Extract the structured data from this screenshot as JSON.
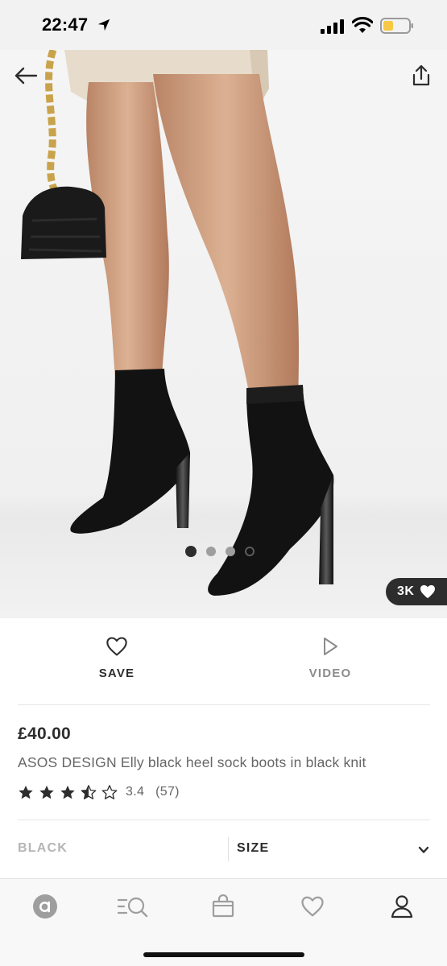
{
  "status_bar": {
    "time": "22:47",
    "icons": [
      "location-arrow-icon",
      "cellular-signal-icon",
      "wifi-icon",
      "battery-icon"
    ]
  },
  "gallery": {
    "image_count": 4,
    "active_index": 0,
    "like_count": "3K",
    "icons": {
      "back": "back-arrow-icon",
      "share": "share-icon",
      "like": "heart-icon"
    }
  },
  "actions": {
    "save_label": "SAVE",
    "video_label": "VIDEO",
    "icons": {
      "save": "heart-outline-icon",
      "video": "play-outline-icon"
    }
  },
  "product": {
    "price": "£40.00",
    "title": "ASOS DESIGN Elly black heel sock boots in black knit",
    "rating_value": "3.4",
    "rating_count": "(57)",
    "stars": 3.5,
    "stars_max": 5
  },
  "selectors": {
    "colour": "BLACK",
    "size_label": "SIZE"
  },
  "tab_bar": {
    "items": [
      "home-icon",
      "search-icon",
      "bag-icon",
      "saved-icon",
      "account-icon"
    ]
  },
  "colors": {
    "text_primary": "#2d2d2d",
    "text_secondary": "#666666",
    "text_muted": "#8c8c8c",
    "badge_bg": "#2d2d2d"
  }
}
